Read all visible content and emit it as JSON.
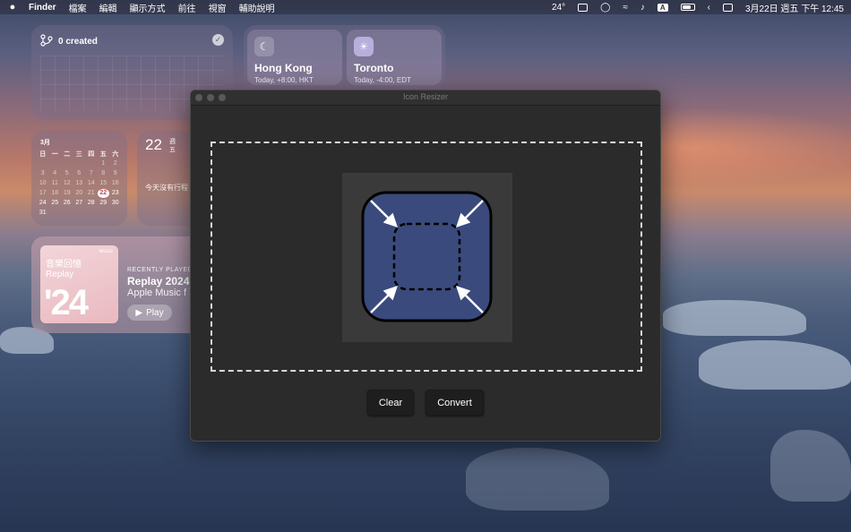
{
  "menubar": {
    "app_name": "Finder",
    "items": [
      "檔案",
      "編輯",
      "顯示方式",
      "前往",
      "視窗",
      "輔助說明"
    ],
    "temperature": "24°",
    "input_source": "A",
    "datetime": "3月22日 週五 下午 12:45"
  },
  "git_widget": {
    "count_label": "0 created"
  },
  "world_clock": [
    {
      "city": "Hong Kong",
      "detail": "Today, +8:00, HKT",
      "icon": "moon-icon"
    },
    {
      "city": "Toronto",
      "detail": "Today, -4:00, EDT",
      "icon": "sun-icon"
    }
  ],
  "calendar": {
    "month": "3月",
    "weekdays": [
      "日",
      "一",
      "二",
      "三",
      "四",
      "五",
      "六"
    ],
    "leading_blanks": 5,
    "days": 31,
    "today": 22
  },
  "day_widget": {
    "day_number": "22",
    "weekday_line1": "週",
    "weekday_line2": "五",
    "no_events": "今天沒有行程"
  },
  "music_widget": {
    "album_badge": "Music",
    "album_title_line1": "音樂回憶",
    "album_title_line2": "Replay",
    "album_year": "'24",
    "recently_played": "RECENTLY PLAYED",
    "title": "Replay 2024",
    "subtitle": "Apple Music f",
    "play_label": "Play"
  },
  "window": {
    "title": "Icon Resizer",
    "clear_label": "Clear",
    "convert_label": "Convert"
  },
  "colors": {
    "icon_fill": "#3a4a7c",
    "window_bg": "#2b2b2b",
    "button_bg": "#1e1e1e",
    "calendar_today": "#c0485a"
  }
}
